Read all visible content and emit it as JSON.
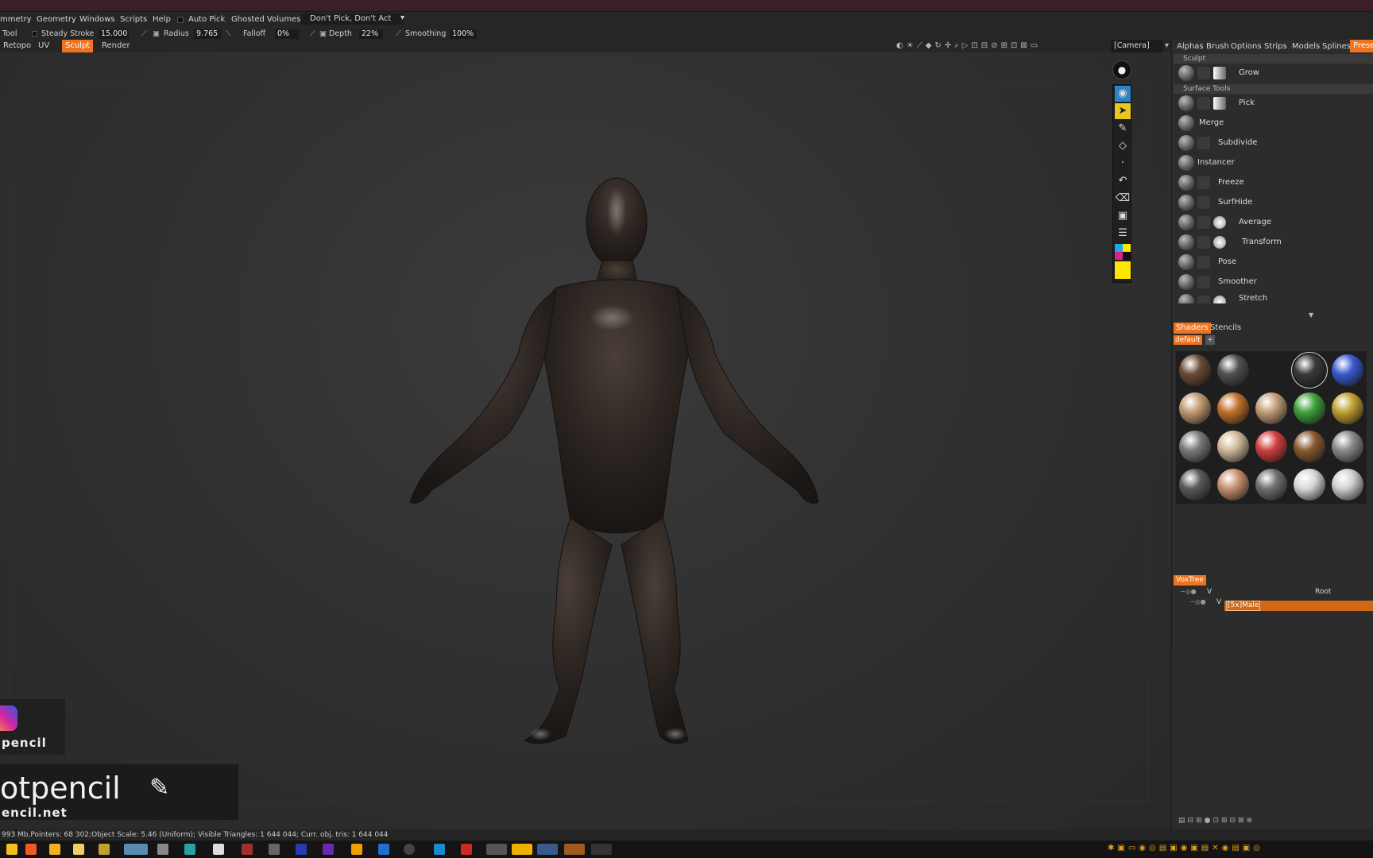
{
  "menu": [
    "mmetry",
    "Geometry",
    "Windows",
    "Scripts",
    "Help",
    "Auto Pick",
    "Ghosted Volumes:",
    "Don't Pick, Don't Act"
  ],
  "toolbar": {
    "tool": "Tool",
    "steady_label": "Steady Stroke",
    "steady_val": "15.000",
    "radius_label": "Radius",
    "radius_val": "9.765",
    "falloff_label": "Falloff",
    "falloff_val": "0%",
    "depth_label": "Depth",
    "depth_val": "22%",
    "smoothing_label": "Smoothing",
    "smoothing_val": "100%"
  },
  "rooms": [
    "Retopo",
    "UV",
    "Sculpt",
    "Render"
  ],
  "camera": "[Camera]",
  "right_tabs": [
    "Alphas",
    "Brush",
    "Options",
    "Strips",
    "Models",
    "Splines",
    "Prese"
  ],
  "sections": {
    "sculpt": "Sculpt",
    "surface": "Surface Tools"
  },
  "brushes": [
    "Grow",
    "Pick",
    "Merge",
    "Subdivide",
    "Instancer",
    "Freeze",
    "SurfHide",
    "Average",
    "Transform",
    "Pose",
    "Smoother",
    "Stretch"
  ],
  "shader_tabs": [
    "Shaders",
    "Stencils"
  ],
  "shader_preset": "default",
  "shader_colors": [
    [
      "#6a4a35",
      "#505050",
      "#1e1e1e",
      "#3a3a3a",
      "#3a5ad0"
    ],
    [
      "#c09a70",
      "#c0702a",
      "#c49c78",
      "#3fa03a",
      "#c0a030"
    ],
    [
      "#7a7a7a",
      "#d0b898",
      "#d04040",
      "#8a5a30",
      "#8a8a8a"
    ],
    [
      "#5a5a5a",
      "#c89070",
      "#707070",
      "#d8d8d8",
      "#d0d0d0"
    ]
  ],
  "voxtree": {
    "tab": "VoxTree",
    "root": "Root",
    "child": "[5x]Male"
  },
  "status": "993 Mb,Pointers: 68 302;Object Scale: 5.46 (Uniform); Visible Triangles: 1 644 044; Curr. obj. tris: 1 644 044",
  "watermark": {
    "small": "pencil",
    "big": "otpencil",
    "url": "encil.net"
  }
}
